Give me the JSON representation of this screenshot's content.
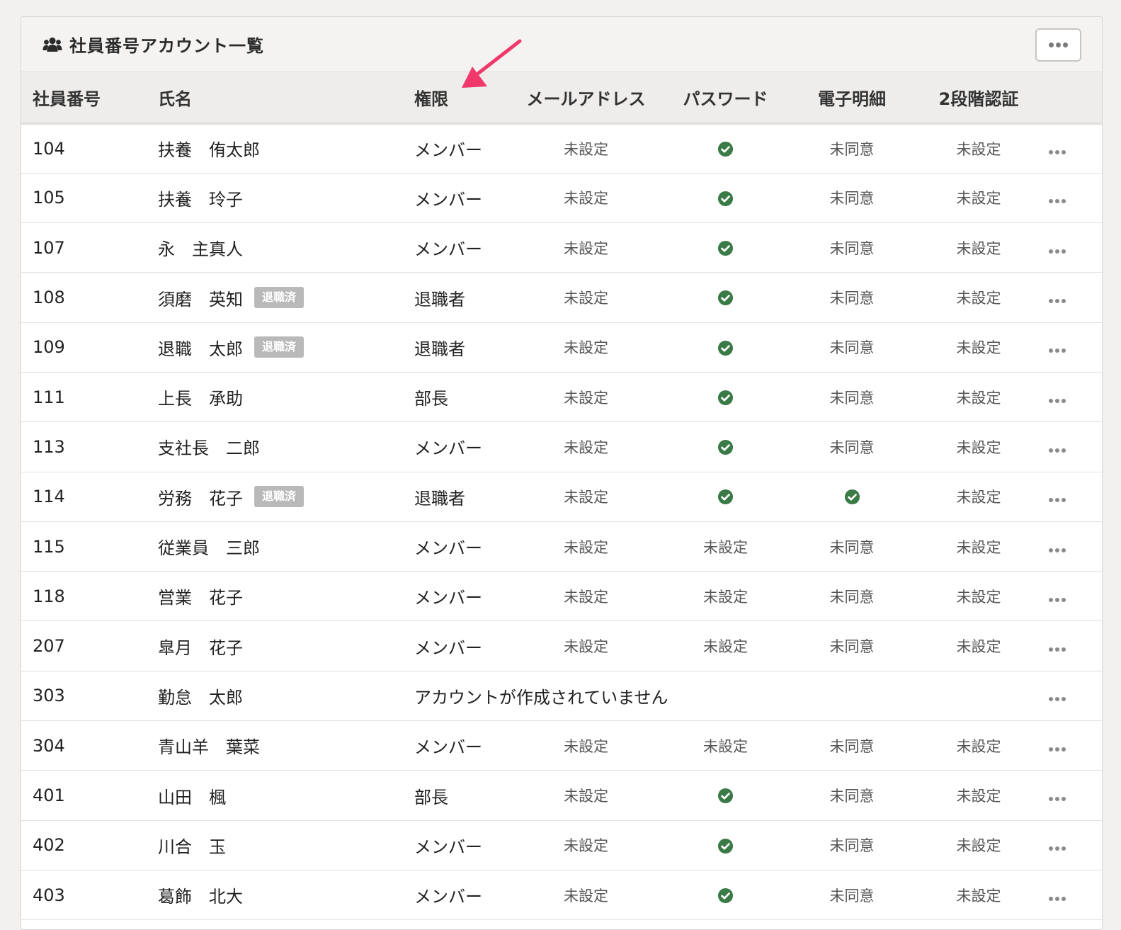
{
  "panel": {
    "title": "社員番号アカウント一覧",
    "title_icon": "users-icon",
    "menu_icon": "more-horizontal-icon"
  },
  "columns": [
    "社員番号",
    "氏名",
    "権限",
    "メールアドレス",
    "パスワード",
    "電子明細",
    "2段階認証"
  ],
  "status_icon": "check-circle-icon",
  "colors": {
    "check": "#3a7a46",
    "badge": "#b9b9b9",
    "annotation_arrow": "#f0386b"
  },
  "rows": [
    {
      "id": "104",
      "name": "扶養　侑太郎",
      "badge": "",
      "role": "メンバー",
      "email": "未設定",
      "password": "check",
      "payslip": "未同意",
      "twofa": "未設定"
    },
    {
      "id": "105",
      "name": "扶養　玲子",
      "badge": "",
      "role": "メンバー",
      "email": "未設定",
      "password": "check",
      "payslip": "未同意",
      "twofa": "未設定"
    },
    {
      "id": "107",
      "name": "永　主真人",
      "badge": "",
      "role": "メンバー",
      "email": "未設定",
      "password": "check",
      "payslip": "未同意",
      "twofa": "未設定"
    },
    {
      "id": "108",
      "name": "須磨　英知",
      "badge": "退職済",
      "role": "退職者",
      "email": "未設定",
      "password": "check",
      "payslip": "未同意",
      "twofa": "未設定"
    },
    {
      "id": "109",
      "name": "退職　太郎",
      "badge": "退職済",
      "role": "退職者",
      "email": "未設定",
      "password": "check",
      "payslip": "未同意",
      "twofa": "未設定"
    },
    {
      "id": "111",
      "name": "上長　承助",
      "badge": "",
      "role": "部長",
      "email": "未設定",
      "password": "check",
      "payslip": "未同意",
      "twofa": "未設定"
    },
    {
      "id": "113",
      "name": "支社長　二郎",
      "badge": "",
      "role": "メンバー",
      "email": "未設定",
      "password": "check",
      "payslip": "未同意",
      "twofa": "未設定"
    },
    {
      "id": "114",
      "name": "労務　花子",
      "badge": "退職済",
      "role": "退職者",
      "email": "未設定",
      "password": "check",
      "payslip": "check",
      "twofa": "未設定"
    },
    {
      "id": "115",
      "name": "従業員　三郎",
      "badge": "",
      "role": "メンバー",
      "email": "未設定",
      "password": "未設定",
      "payslip": "未同意",
      "twofa": "未設定"
    },
    {
      "id": "118",
      "name": "営業　花子",
      "badge": "",
      "role": "メンバー",
      "email": "未設定",
      "password": "未設定",
      "payslip": "未同意",
      "twofa": "未設定"
    },
    {
      "id": "207",
      "name": "皐月　花子",
      "badge": "",
      "role": "メンバー",
      "email": "未設定",
      "password": "未設定",
      "payslip": "未同意",
      "twofa": "未設定"
    },
    {
      "id": "303",
      "name": "勤怠　太郎",
      "badge": "",
      "no_account": "アカウントが作成されていません"
    },
    {
      "id": "304",
      "name": "青山羊　葉菜",
      "badge": "",
      "role": "メンバー",
      "email": "未設定",
      "password": "未設定",
      "payslip": "未同意",
      "twofa": "未設定"
    },
    {
      "id": "401",
      "name": "山田　楓",
      "badge": "",
      "role": "部長",
      "email": "未設定",
      "password": "check",
      "payslip": "未同意",
      "twofa": "未設定"
    },
    {
      "id": "402",
      "name": "川合　玉",
      "badge": "",
      "role": "メンバー",
      "email": "未設定",
      "password": "check",
      "payslip": "未同意",
      "twofa": "未設定"
    },
    {
      "id": "403",
      "name": "葛飾　北大",
      "badge": "",
      "role": "メンバー",
      "email": "未設定",
      "password": "check",
      "payslip": "未同意",
      "twofa": "未設定"
    }
  ]
}
